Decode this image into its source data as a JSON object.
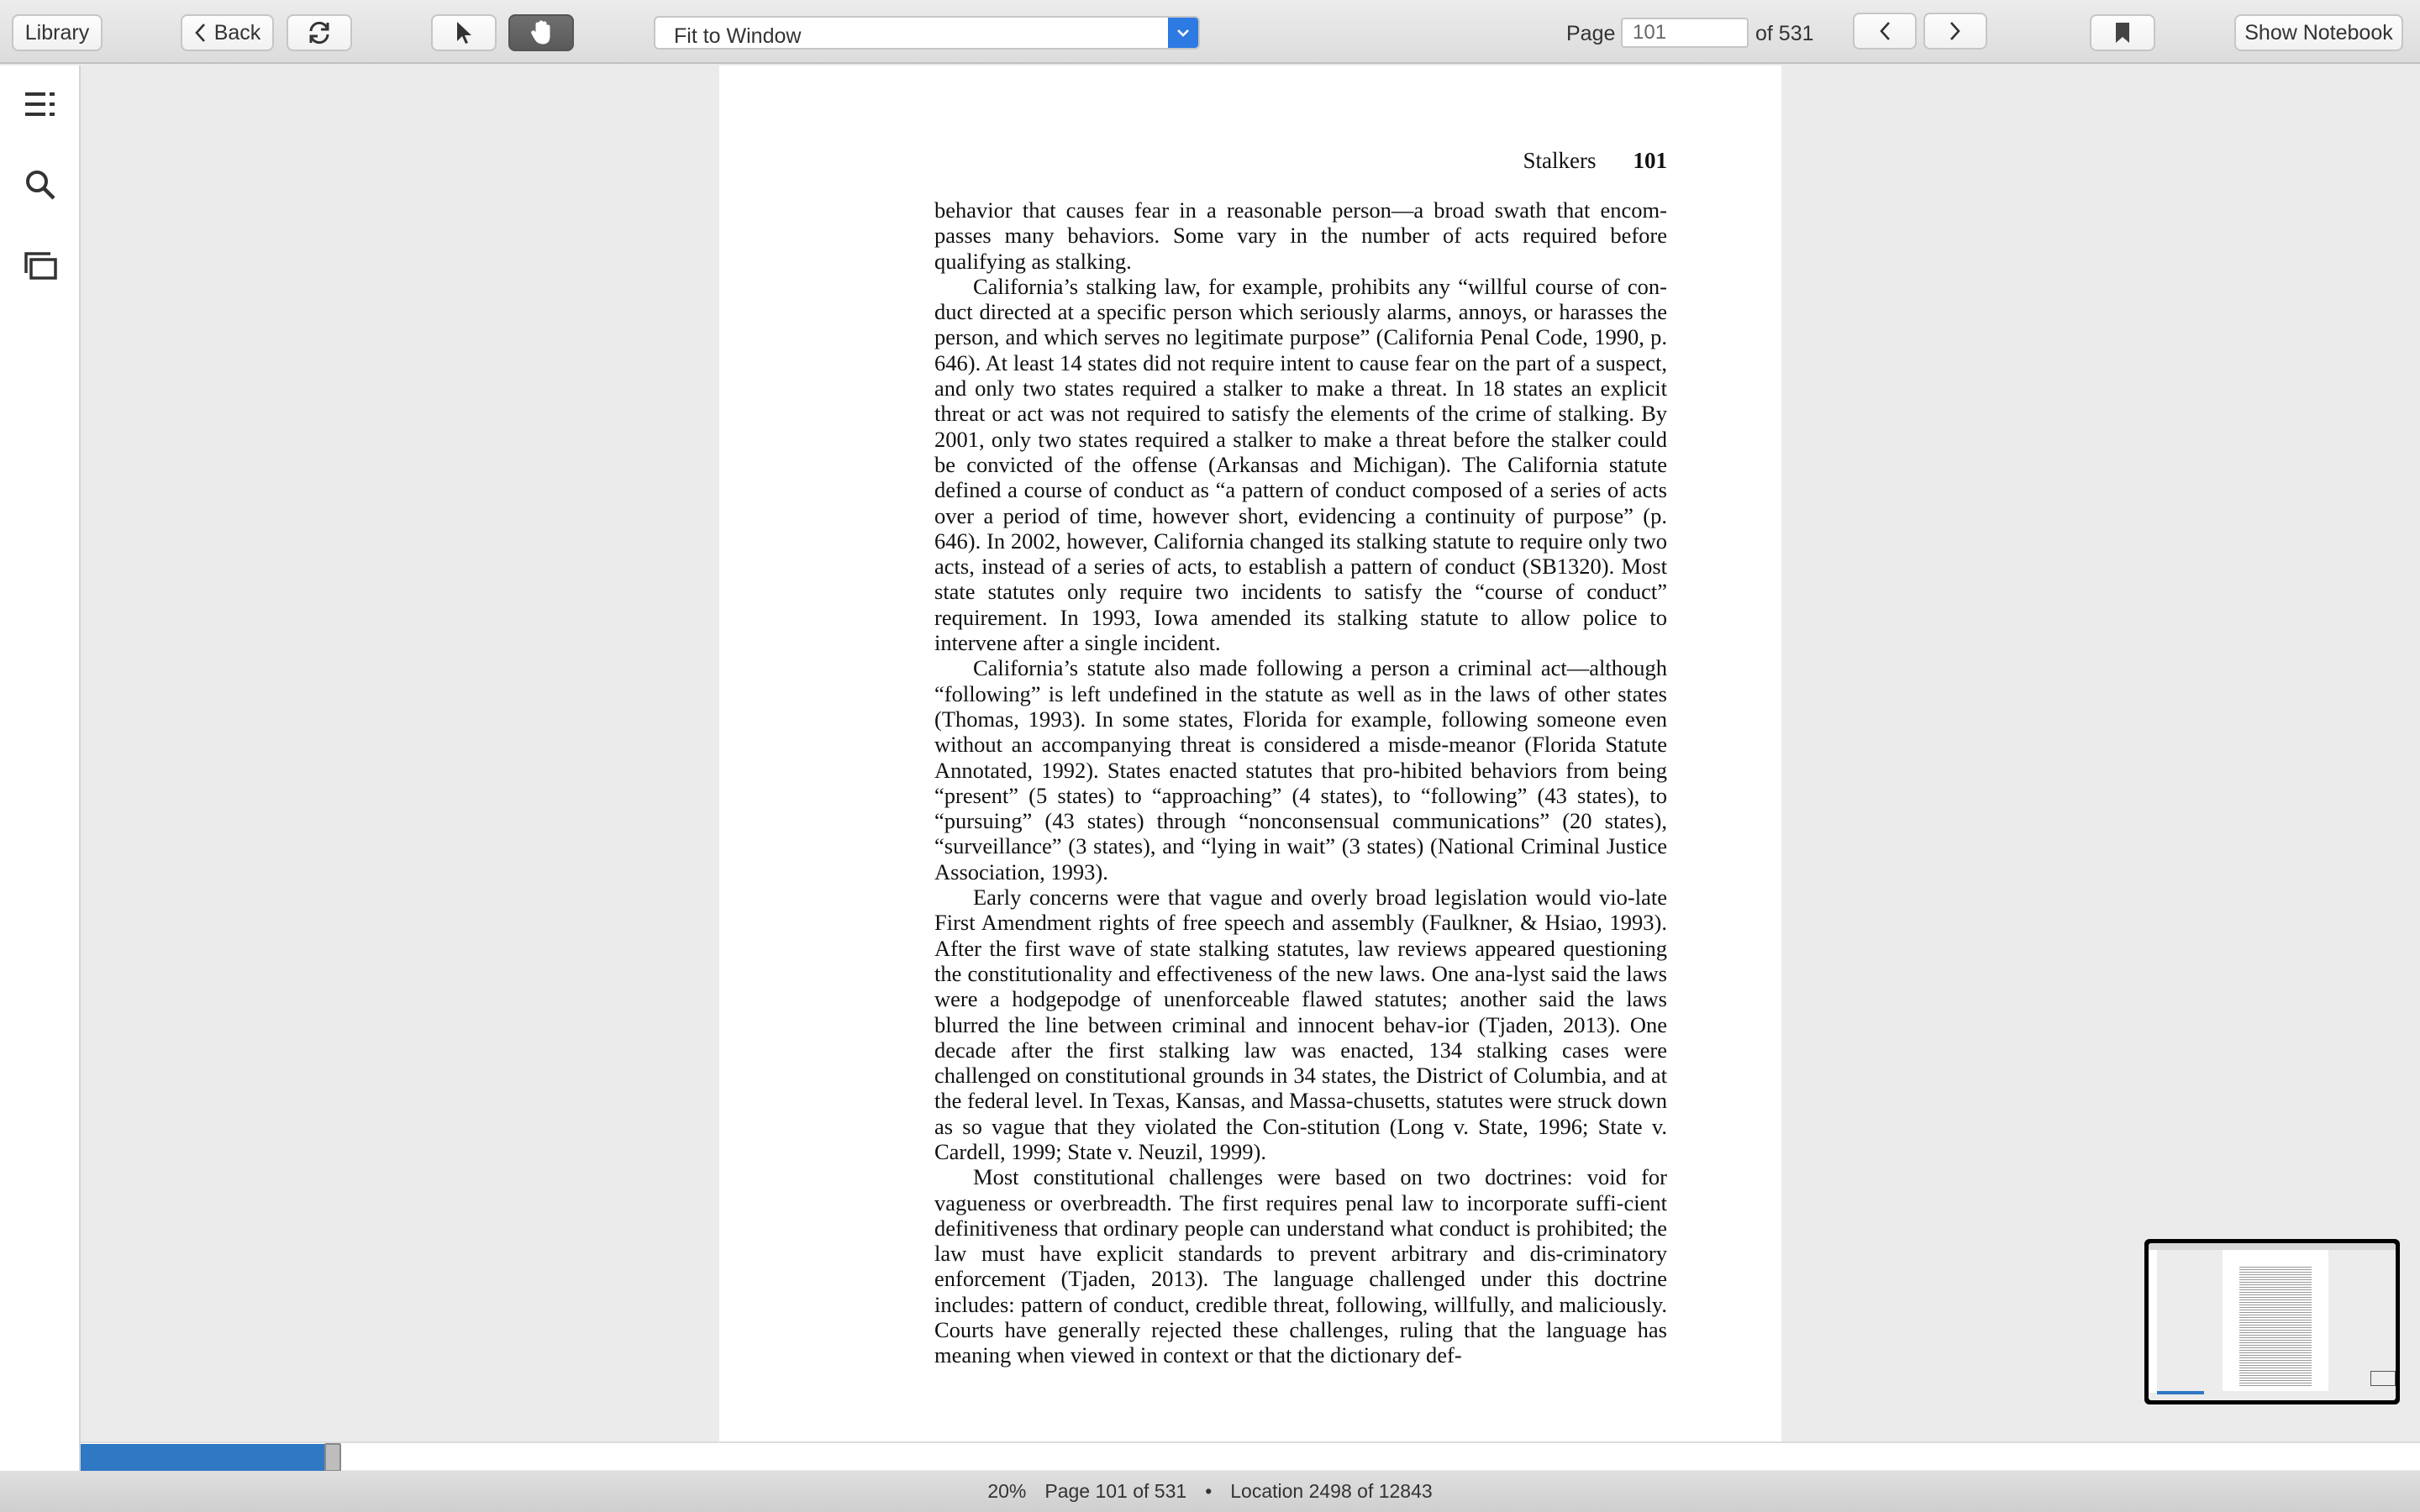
{
  "toolbar": {
    "library_label": "Library",
    "back_label": "Back",
    "zoom_mode": "Fit to Window",
    "page_label": "Page",
    "page_value": "101",
    "page_total": "of 531",
    "show_notebook_label": "Show Notebook"
  },
  "page": {
    "running_head_title": "Stalkers",
    "running_head_number": "101",
    "paragraphs": [
      "behavior that causes fear in a reasonable person—a broad swath that encom-passes many behaviors. Some vary in the number of acts required before qualifying as stalking.",
      "California’s stalking law, for example, prohibits any “willful course of con-duct directed at a specific person which seriously alarms, annoys, or harasses the person, and which serves no legitimate purpose” (California Penal Code, 1990, p. 646). At least 14 states did not require intent to cause fear on the part of a suspect, and only two states required a stalker to make a threat. In 18 states an explicit threat or act was not required to satisfy the elements of the crime of stalking. By 2001, only two states required a stalker to make a threat before the stalker could be convicted of the offense (Arkansas and Michigan). The California statute defined a course of conduct as “a pattern of conduct composed of a series of acts over a period of time, however short, evidencing a continuity of purpose” (p. 646). In 2002, however, California changed its stalking statute to require only two acts, instead of a series of acts, to establish a pattern of conduct (SB1320). Most state statutes only require two incidents to satisfy the “course of conduct” requirement. In 1993, Iowa amended its stalking statute to allow police to intervene after a single incident.",
      "California’s statute also made following a person a criminal act—although “following” is left undefined in the statute as well as in the laws of other states (Thomas, 1993). In some states, Florida for example, following someone even without an accompanying threat is considered a misde-meanor (Florida Statute Annotated, 1992). States enacted statutes that pro-hibited behaviors from being “present” (5 states) to “approaching” (4 states), to “following” (43 states), to “pursuing” (43 states) through “nonconsensual communications” (20 states), “surveillance” (3 states), and “lying in wait” (3 states) (National Criminal Justice Association, 1993).",
      "Early concerns were that vague and overly broad legislation would vio-late First Amendment rights of free speech and assembly (Faulkner, & Hsiao, 1993). After the first wave of state stalking statutes, law reviews appeared questioning the constitutionality and effectiveness of the new laws. One ana-lyst said the laws were a hodgepodge of unenforceable flawed statutes; another said the laws blurred the line between criminal and innocent behav-ior (Tjaden, 2013). One decade after the first stalking law was enacted, 134 stalking cases were challenged on constitutional grounds in 34 states, the District of Columbia, and at the federal level. In Texas, Kansas, and Massa-chusetts, statutes were struck down as so vague that they violated the Con-stitution (Long v. State, 1996; State v. Cardell, 1999; State v. Neuzil, 1999).",
      "Most constitutional challenges were based on two doctrines: void for vagueness or overbreadth. The first requires penal law to incorporate suffi-cient definitiveness that ordinary people can understand what conduct is prohibited; the law must have explicit standards to prevent arbitrary and dis-criminatory enforcement (Tjaden, 2013). The language challenged under this doctrine includes: pattern of conduct, credible threat, following, willfully, and maliciously. Courts have generally rejected these challenges, ruling that the language has meaning when viewed in context or that the dictionary def-"
    ]
  },
  "progress": {
    "fraction": 0.105
  },
  "status": {
    "percent": "20%",
    "page_info": "Page 101 of 531",
    "separator": "•",
    "location": "Location 2498 of 12843"
  },
  "colors": {
    "accent": "#2f78c4",
    "select_arrow": "#2d7ae3"
  },
  "icons": [
    "back-chevron-icon",
    "sync-icon",
    "arrow-pointer-icon",
    "hand-icon",
    "chevron-left-icon",
    "chevron-right-icon",
    "bookmark-icon",
    "toc-icon",
    "search-icon",
    "cards-icon"
  ]
}
